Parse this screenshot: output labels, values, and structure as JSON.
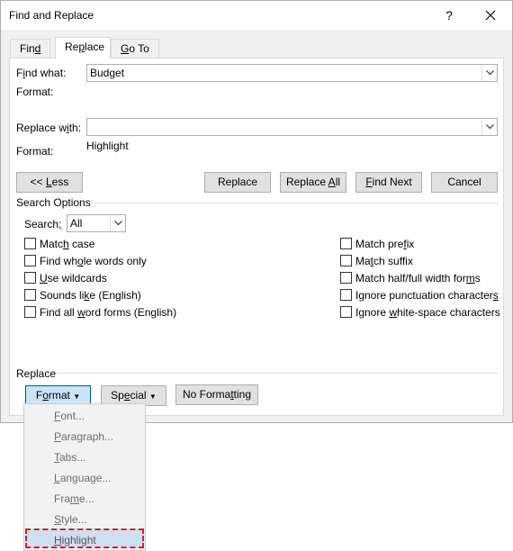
{
  "window": {
    "title": "Find and Replace",
    "help_icon": "question-mark-icon",
    "close_icon": "close-icon"
  },
  "tabs": [
    {
      "label": "Find",
      "mnemonic": "d",
      "active": false
    },
    {
      "label": "Replace",
      "mnemonic": "p",
      "active": true
    },
    {
      "label": "Go To",
      "mnemonic": "G",
      "active": false
    }
  ],
  "find": {
    "label": "Find what:",
    "value": "Budget",
    "format_label": "Format:",
    "format_value": ""
  },
  "replace": {
    "label": "Replace with:",
    "value": "",
    "format_label": "Format:",
    "format_value": "Highlight"
  },
  "buttons": {
    "less": "<< Less",
    "replace": "Replace",
    "replace_all": "Replace All",
    "find_next": "Find Next",
    "cancel": "Cancel"
  },
  "search_options": {
    "title": "Search Options",
    "search_label": "Search:",
    "search_value": "All",
    "left": [
      {
        "label": "Match case",
        "checked": false
      },
      {
        "label": "Find whole words only",
        "checked": false
      },
      {
        "label": "Use wildcards",
        "checked": false
      },
      {
        "label": "Sounds like (English)",
        "checked": false
      },
      {
        "label": "Find all word forms (English)",
        "checked": false
      }
    ],
    "right": [
      {
        "label": "Match prefix",
        "checked": false
      },
      {
        "label": "Match suffix",
        "checked": false
      },
      {
        "label": "Match half/full width forms",
        "checked": false
      },
      {
        "label": "Ignore punctuation characters",
        "checked": false
      },
      {
        "label": "Ignore white-space characters",
        "checked": false
      }
    ]
  },
  "replace_group": {
    "title": "Replace",
    "format_button": "Format",
    "special_button": "Special",
    "no_formatting_button": "No Formatting"
  },
  "format_menu": {
    "items": [
      "Font...",
      "Paragraph...",
      "Tabs...",
      "Language...",
      "Frame...",
      "Style...",
      "Highlight"
    ],
    "highlighted": "Highlight"
  },
  "colors": {
    "highlight_border": "#d11f2a",
    "menu_selection": "#cfe0f3",
    "pressed_button": "#cce4f7"
  }
}
